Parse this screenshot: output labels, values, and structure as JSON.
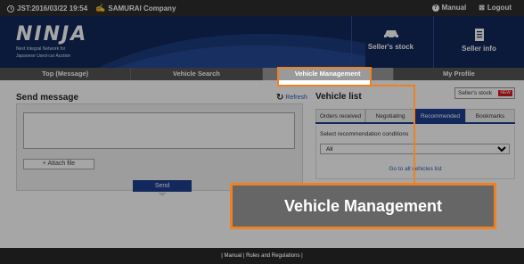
{
  "topbar": {
    "datetime": "JST:2016/03/22 19:54",
    "company": "SAMURAI Company",
    "manual": "Manual",
    "logout": "Logout"
  },
  "brand": {
    "logo": "NINJA",
    "tagline_line1": "Next Integral Network for",
    "tagline_line2": "Japanese Used-car Auction",
    "primary_color": "#12275a",
    "accent_color": "#ee8222"
  },
  "header_buttons": {
    "sellers_stock": "Seller's stock",
    "seller_info": "Seller info"
  },
  "nav": {
    "tabs": [
      {
        "label": "Top (Message)"
      },
      {
        "label": "Vehicle Search"
      },
      {
        "label": "Vehicle Management"
      },
      {
        "label": "My Profile"
      }
    ]
  },
  "send_message": {
    "title": "Send message",
    "attach_label": "+ Attach file",
    "send_label": "Send"
  },
  "vehicle_list": {
    "refresh_label": "Refresh",
    "title": "Vehicle list",
    "sellers_stock_label": "Seller's stock",
    "new_badge": "NEW",
    "tabs": [
      {
        "label": "Orders received"
      },
      {
        "label": "Negotiating"
      },
      {
        "label": "Recommended"
      },
      {
        "label": "Bookmarks"
      }
    ],
    "select_label": "Select recommendation conditions",
    "select_value": "All",
    "go_all_link": "Go to all vehicles list"
  },
  "callout": {
    "text": "Vehicle Management"
  },
  "footer": {
    "text": "| Manual | Rules and Regulations |"
  }
}
